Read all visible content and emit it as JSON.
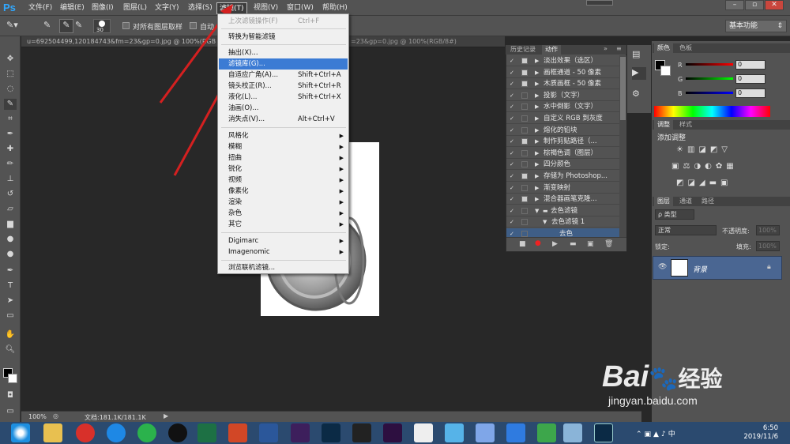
{
  "app": {
    "logo": "Ps"
  },
  "menubar": {
    "items": [
      "文件(F)",
      "编辑(E)",
      "图像(I)",
      "图层(L)",
      "文字(Y)",
      "选择(S)",
      "滤镜(T)",
      "视图(V)",
      "窗口(W)",
      "帮助(H)"
    ],
    "active_index": 6
  },
  "window_controls": {
    "minimize": "–",
    "restore": "▫",
    "close": "✕"
  },
  "options_bar": {
    "brush_size": "30",
    "sample_all_layers": "对所有图层取样",
    "auto_enhance": "自动",
    "workspace": "基本功能"
  },
  "document": {
    "tab_title": "u=692504499,120184743&fm=23&gp=0.jpg @ 100%(RGB",
    "tab_title_right": "=23&gp=0.jpg @ 100%(RGB/8#)",
    "zoom": "100%",
    "doc_info": "文档:181.1K/181.1K"
  },
  "filter_menu": {
    "items": [
      {
        "label": "上次滤镜操作(F)",
        "shortcut": "Ctrl+F",
        "disabled": true
      },
      {
        "label": "转换为智能滤镜"
      },
      {
        "label": "抽出(X)..."
      },
      {
        "label": "滤镜库(G)...",
        "highlight": true
      },
      {
        "label": "自适应广角(A)...",
        "shortcut": "Shift+Ctrl+A"
      },
      {
        "label": "镜头校正(R)...",
        "shortcut": "Shift+Ctrl+R"
      },
      {
        "label": "液化(L)...",
        "shortcut": "Shift+Ctrl+X"
      },
      {
        "label": "油画(O)..."
      },
      {
        "label": "消失点(V)...",
        "shortcut": "Alt+Ctrl+V"
      },
      {
        "label": "风格化",
        "submenu": true
      },
      {
        "label": "模糊",
        "submenu": true
      },
      {
        "label": "扭曲",
        "submenu": true
      },
      {
        "label": "锐化",
        "submenu": true
      },
      {
        "label": "视频",
        "submenu": true
      },
      {
        "label": "像素化",
        "submenu": true
      },
      {
        "label": "渲染",
        "submenu": true
      },
      {
        "label": "杂色",
        "submenu": true
      },
      {
        "label": "其它",
        "submenu": true
      },
      {
        "label": "Digimarc",
        "submenu": true
      },
      {
        "label": "Imagenomic",
        "submenu": true
      },
      {
        "label": "浏览联机滤镜..."
      }
    ]
  },
  "actions_panel": {
    "tabs": [
      "历史记录",
      "动作"
    ],
    "rows": [
      {
        "label": "淡出效果（选区）",
        "checked": true,
        "dialog": true
      },
      {
        "label": "画框通道 - 50 像素",
        "checked": true,
        "dialog": true
      },
      {
        "label": "木质画框 - 50 像素",
        "checked": true,
        "dialog": true
      },
      {
        "label": "投影（文字）",
        "checked": true,
        "dialog": false
      },
      {
        "label": "水中倒影（文字）",
        "checked": true,
        "dialog": false
      },
      {
        "label": "自定义 RGB 到灰度",
        "checked": true,
        "dialog": false
      },
      {
        "label": "熔化的铅块",
        "checked": true,
        "dialog": false
      },
      {
        "label": "制作剪贴路径（...",
        "checked": true,
        "dialog": true
      },
      {
        "label": "棕褐色调（图层）",
        "checked": true,
        "dialog": false
      },
      {
        "label": "四分颜色",
        "checked": true,
        "dialog": false
      },
      {
        "label": "存储为 Photoshop...",
        "checked": true,
        "dialog": true
      },
      {
        "label": "渐变映射",
        "checked": true,
        "dialog": false
      },
      {
        "label": "混合器画笔克隆...",
        "checked": true,
        "dialog": true
      },
      {
        "label": "去色滤镜",
        "checked": true,
        "dialog": false,
        "folder": true
      },
      {
        "label": "去色滤镜 1",
        "checked": true,
        "dialog": false,
        "level": 1
      },
      {
        "label": "去色",
        "checked": true,
        "dialog": false,
        "level": 2,
        "selected": true
      }
    ]
  },
  "color_panel": {
    "tabs": [
      "颜色",
      "色板"
    ],
    "channels": [
      {
        "name": "R",
        "value": "0"
      },
      {
        "name": "G",
        "value": "0"
      },
      {
        "name": "B",
        "value": "0"
      }
    ]
  },
  "adjustments_panel": {
    "tabs": [
      "调整",
      "样式"
    ],
    "title": "添加调整"
  },
  "layers_panel": {
    "tabs": [
      "图层",
      "通道",
      "路径"
    ],
    "kind_filter": "类型",
    "blend_mode": "正常",
    "opacity_label": "不透明度:",
    "opacity": "100%",
    "lock_label": "锁定:",
    "fill_label": "填充:",
    "fill": "100%",
    "layer_name": "背景"
  },
  "taskbar": {
    "apps": [
      "ie",
      "explorer",
      "netease-music",
      "kugou",
      "wechat",
      "qq",
      "excel",
      "powerpoint",
      "word",
      "after-effects",
      "photoshop",
      "premiere",
      "media",
      "premiere-pro",
      "browser",
      "tencent",
      "feishu",
      "360",
      "app",
      "app2",
      "photoshop-active"
    ],
    "time": "6:50",
    "date": "2019/11/6"
  },
  "watermark": {
    "brand": "Bai",
    "brand2": "经验",
    "url": "jingyan.baidu.com"
  },
  "colors": {
    "accent": "#31a8ff",
    "highlight": "#3b7bd4",
    "arrow": "#d42020"
  }
}
